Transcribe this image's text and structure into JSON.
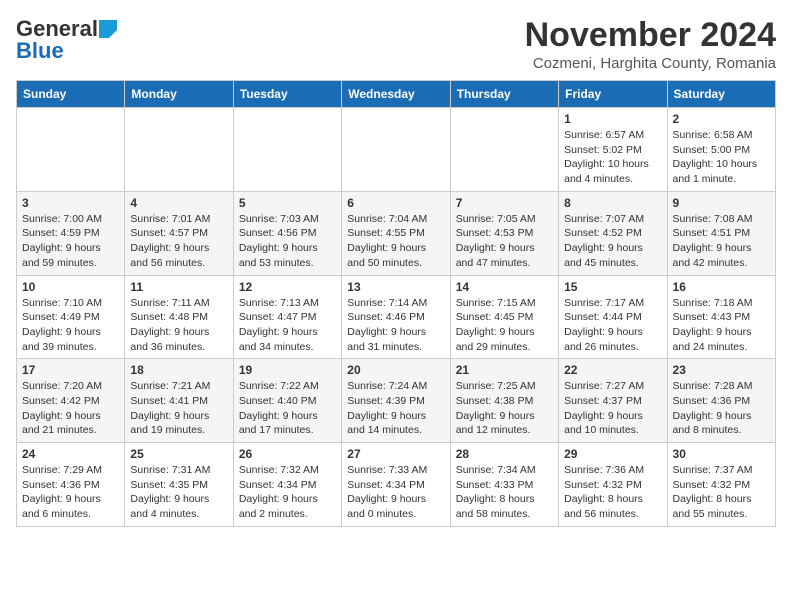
{
  "header": {
    "logo_general": "General",
    "logo_blue": "Blue",
    "month_title": "November 2024",
    "location": "Cozmeni, Harghita County, Romania"
  },
  "weekdays": [
    "Sunday",
    "Monday",
    "Tuesday",
    "Wednesday",
    "Thursday",
    "Friday",
    "Saturday"
  ],
  "weeks": [
    [
      {
        "day": "",
        "info": ""
      },
      {
        "day": "",
        "info": ""
      },
      {
        "day": "",
        "info": ""
      },
      {
        "day": "",
        "info": ""
      },
      {
        "day": "",
        "info": ""
      },
      {
        "day": "1",
        "info": "Sunrise: 6:57 AM\nSunset: 5:02 PM\nDaylight: 10 hours and 4 minutes."
      },
      {
        "day": "2",
        "info": "Sunrise: 6:58 AM\nSunset: 5:00 PM\nDaylight: 10 hours and 1 minute."
      }
    ],
    [
      {
        "day": "3",
        "info": "Sunrise: 7:00 AM\nSunset: 4:59 PM\nDaylight: 9 hours and 59 minutes."
      },
      {
        "day": "4",
        "info": "Sunrise: 7:01 AM\nSunset: 4:57 PM\nDaylight: 9 hours and 56 minutes."
      },
      {
        "day": "5",
        "info": "Sunrise: 7:03 AM\nSunset: 4:56 PM\nDaylight: 9 hours and 53 minutes."
      },
      {
        "day": "6",
        "info": "Sunrise: 7:04 AM\nSunset: 4:55 PM\nDaylight: 9 hours and 50 minutes."
      },
      {
        "day": "7",
        "info": "Sunrise: 7:05 AM\nSunset: 4:53 PM\nDaylight: 9 hours and 47 minutes."
      },
      {
        "day": "8",
        "info": "Sunrise: 7:07 AM\nSunset: 4:52 PM\nDaylight: 9 hours and 45 minutes."
      },
      {
        "day": "9",
        "info": "Sunrise: 7:08 AM\nSunset: 4:51 PM\nDaylight: 9 hours and 42 minutes."
      }
    ],
    [
      {
        "day": "10",
        "info": "Sunrise: 7:10 AM\nSunset: 4:49 PM\nDaylight: 9 hours and 39 minutes."
      },
      {
        "day": "11",
        "info": "Sunrise: 7:11 AM\nSunset: 4:48 PM\nDaylight: 9 hours and 36 minutes."
      },
      {
        "day": "12",
        "info": "Sunrise: 7:13 AM\nSunset: 4:47 PM\nDaylight: 9 hours and 34 minutes."
      },
      {
        "day": "13",
        "info": "Sunrise: 7:14 AM\nSunset: 4:46 PM\nDaylight: 9 hours and 31 minutes."
      },
      {
        "day": "14",
        "info": "Sunrise: 7:15 AM\nSunset: 4:45 PM\nDaylight: 9 hours and 29 minutes."
      },
      {
        "day": "15",
        "info": "Sunrise: 7:17 AM\nSunset: 4:44 PM\nDaylight: 9 hours and 26 minutes."
      },
      {
        "day": "16",
        "info": "Sunrise: 7:18 AM\nSunset: 4:43 PM\nDaylight: 9 hours and 24 minutes."
      }
    ],
    [
      {
        "day": "17",
        "info": "Sunrise: 7:20 AM\nSunset: 4:42 PM\nDaylight: 9 hours and 21 minutes."
      },
      {
        "day": "18",
        "info": "Sunrise: 7:21 AM\nSunset: 4:41 PM\nDaylight: 9 hours and 19 minutes."
      },
      {
        "day": "19",
        "info": "Sunrise: 7:22 AM\nSunset: 4:40 PM\nDaylight: 9 hours and 17 minutes."
      },
      {
        "day": "20",
        "info": "Sunrise: 7:24 AM\nSunset: 4:39 PM\nDaylight: 9 hours and 14 minutes."
      },
      {
        "day": "21",
        "info": "Sunrise: 7:25 AM\nSunset: 4:38 PM\nDaylight: 9 hours and 12 minutes."
      },
      {
        "day": "22",
        "info": "Sunrise: 7:27 AM\nSunset: 4:37 PM\nDaylight: 9 hours and 10 minutes."
      },
      {
        "day": "23",
        "info": "Sunrise: 7:28 AM\nSunset: 4:36 PM\nDaylight: 9 hours and 8 minutes."
      }
    ],
    [
      {
        "day": "24",
        "info": "Sunrise: 7:29 AM\nSunset: 4:36 PM\nDaylight: 9 hours and 6 minutes."
      },
      {
        "day": "25",
        "info": "Sunrise: 7:31 AM\nSunset: 4:35 PM\nDaylight: 9 hours and 4 minutes."
      },
      {
        "day": "26",
        "info": "Sunrise: 7:32 AM\nSunset: 4:34 PM\nDaylight: 9 hours and 2 minutes."
      },
      {
        "day": "27",
        "info": "Sunrise: 7:33 AM\nSunset: 4:34 PM\nDaylight: 9 hours and 0 minutes."
      },
      {
        "day": "28",
        "info": "Sunrise: 7:34 AM\nSunset: 4:33 PM\nDaylight: 8 hours and 58 minutes."
      },
      {
        "day": "29",
        "info": "Sunrise: 7:36 AM\nSunset: 4:32 PM\nDaylight: 8 hours and 56 minutes."
      },
      {
        "day": "30",
        "info": "Sunrise: 7:37 AM\nSunset: 4:32 PM\nDaylight: 8 hours and 55 minutes."
      }
    ]
  ]
}
